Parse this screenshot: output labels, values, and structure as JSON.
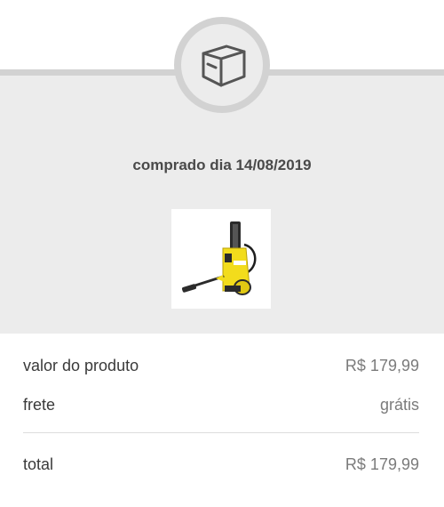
{
  "header": {
    "icon": "box-icon"
  },
  "order": {
    "purchase_date_text": "comprado dia 14/08/2019",
    "product_image": "pressure-washer-product-image"
  },
  "summary": {
    "product_value_label": "valor do produto",
    "product_value": "R$ 179,99",
    "shipping_label": "frete",
    "shipping_value": "grátis",
    "total_label": "total",
    "total_value": "R$ 179,99"
  },
  "colors": {
    "panel_background": "#ececec",
    "ring": "#d2d2d2",
    "product_accent": "#f2dc1c"
  }
}
